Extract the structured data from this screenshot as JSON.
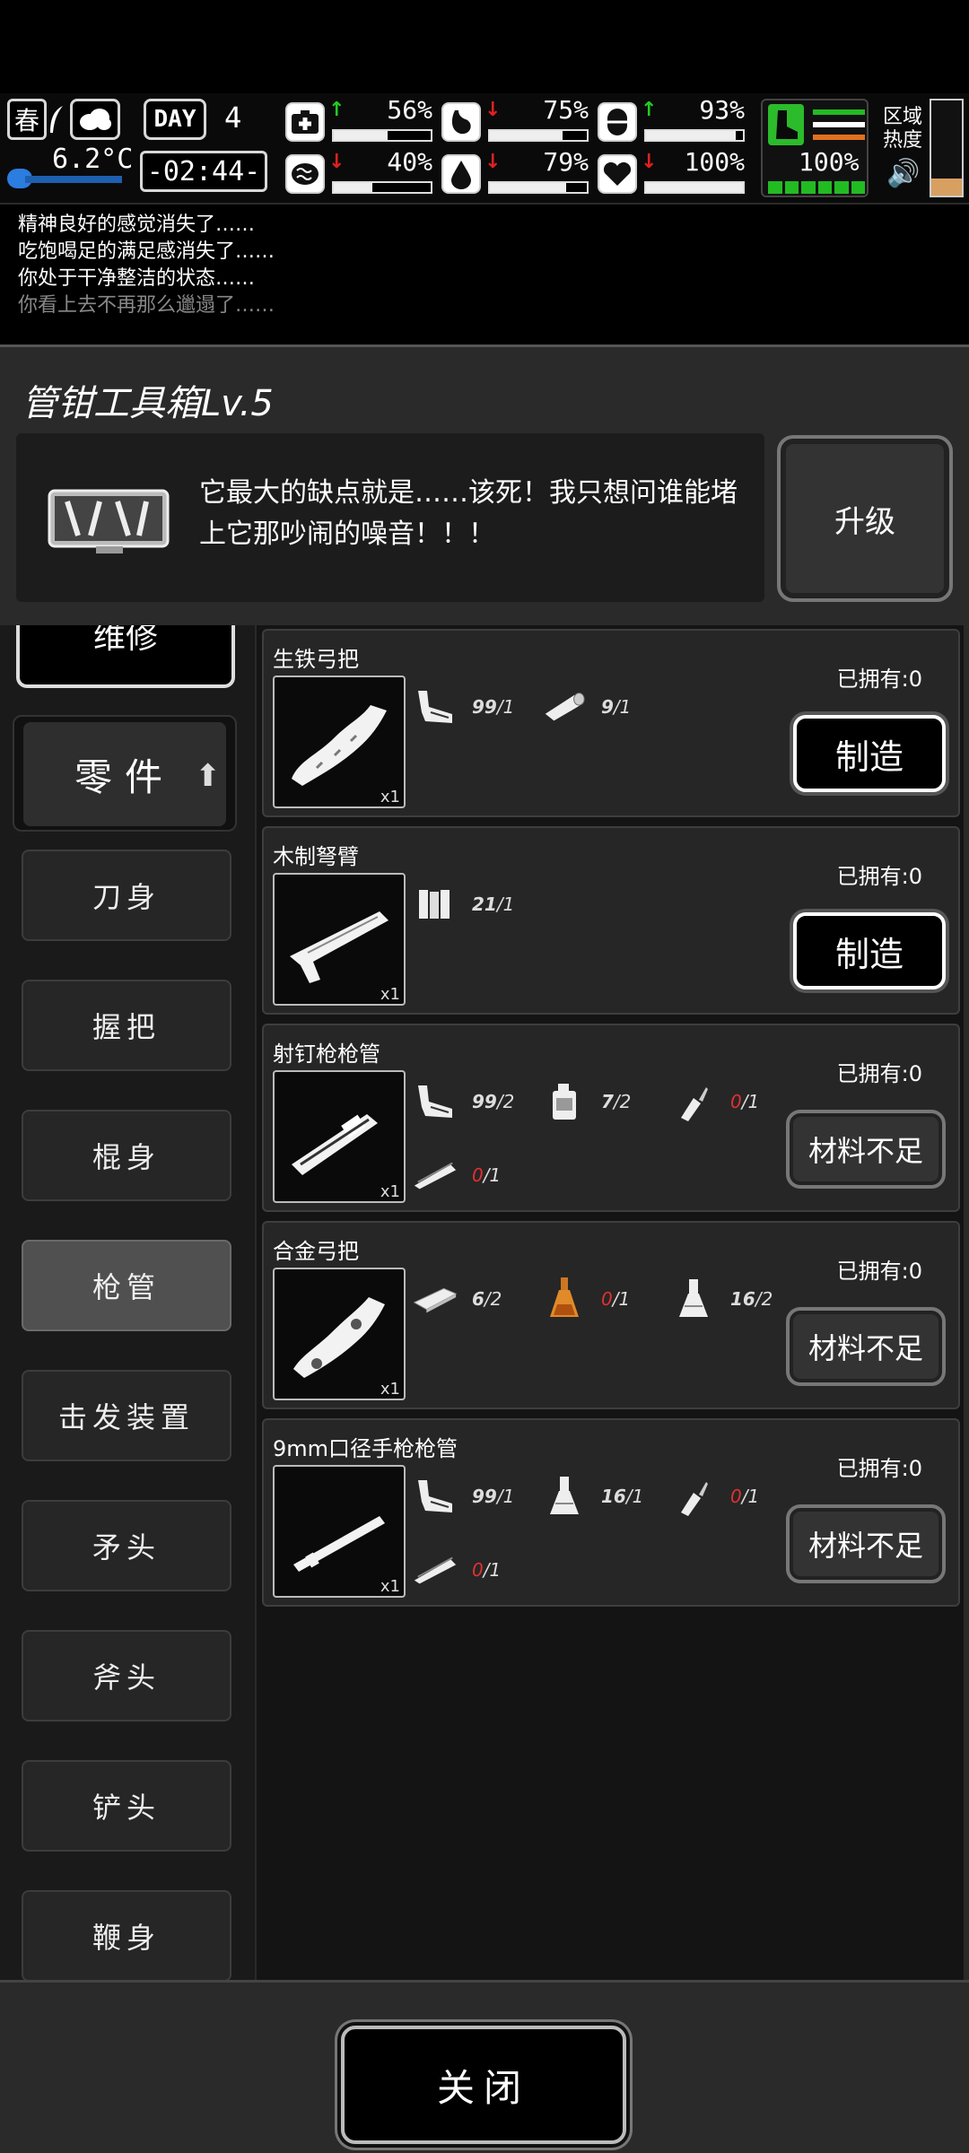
{
  "hud": {
    "season": "春",
    "temperature": "6.2°C",
    "day_label": "DAY",
    "day_number": "4",
    "clock": "-02:44-",
    "stats": [
      {
        "name": "health",
        "icon": "medkit-icon",
        "trend": "up",
        "value": "56%",
        "level": 0.56
      },
      {
        "name": "hunger",
        "icon": "stomach-icon",
        "trend": "down",
        "value": "75%",
        "level": 0.75
      },
      {
        "name": "energy",
        "icon": "pill-icon",
        "trend": "up",
        "value": "93%",
        "level": 0.93
      },
      {
        "name": "mental",
        "icon": "brain-icon",
        "trend": "down",
        "value": "40%",
        "level": 0.4
      },
      {
        "name": "thirst",
        "icon": "water-drop-icon",
        "trend": "down",
        "value": "79%",
        "level": 0.79
      },
      {
        "name": "mood",
        "icon": "heart-icon",
        "trend": "down",
        "value": "100%",
        "level": 1.0
      }
    ],
    "stamina": "100%",
    "zone_heat_label_1": "区域",
    "zone_heat_label_2": "热度",
    "colors": {
      "up": "#22cc22",
      "down": "#e02020",
      "stamina": "#22bb22",
      "heat": "#d8a060"
    }
  },
  "log": [
    "精神良好的感觉消失了……",
    "吃饱喝足的满足感消失了……",
    "你处于干净整洁的状态……",
    "你看上去不再那么邋遢了……"
  ],
  "panel": {
    "title": "管钳工具箱Lv.5",
    "description": "它最大的缺点就是……该死！我只想问谁能堵上它那吵闹的噪音！！！",
    "upgrade_label": "升级"
  },
  "sidebar": {
    "top_category": "维修",
    "selected_category": "零件",
    "subcategories": [
      "刀身",
      "握把",
      "棍身",
      "枪管",
      "击发装置",
      "矛头",
      "斧头",
      "铲头",
      "鞭身"
    ],
    "active_sub": "枪管"
  },
  "recipes": [
    {
      "name": "生铁弓把",
      "owned": "已拥有:0",
      "qty": "x1",
      "materials": [
        {
          "icon": "pipe-wrench-icon",
          "have": "99",
          "need": "1",
          "lacking": false
        },
        {
          "icon": "log-icon",
          "have": "9",
          "need": "1",
          "lacking": false
        }
      ],
      "button": "制造",
      "can_craft": true
    },
    {
      "name": "木制弩臂",
      "owned": "已拥有:0",
      "qty": "x1",
      "materials": [
        {
          "icon": "planks-icon",
          "have": "21",
          "need": "1",
          "lacking": false
        }
      ],
      "button": "制造",
      "can_craft": true
    },
    {
      "name": "射钉枪枪管",
      "owned": "已拥有:0",
      "qty": "x1",
      "materials": [
        {
          "icon": "pipe-wrench-icon",
          "have": "99",
          "need": "2",
          "lacking": false
        },
        {
          "icon": "jerrycan-icon",
          "have": "7",
          "need": "2",
          "lacking": false
        },
        {
          "icon": "glue-bottle-icon",
          "have": "0",
          "need": "1",
          "lacking": true
        },
        {
          "icon": "metal-pipe-icon",
          "have": "0",
          "need": "1",
          "lacking": true
        }
      ],
      "button": "材料不足",
      "can_craft": false
    },
    {
      "name": "合金弓把",
      "owned": "已拥有:0",
      "qty": "x1",
      "materials": [
        {
          "icon": "metal-bar-icon",
          "have": "6",
          "need": "2",
          "lacking": false
        },
        {
          "icon": "potion-flask-icon",
          "have": "0",
          "need": "1",
          "lacking": true
        },
        {
          "icon": "chemical-flask-icon",
          "have": "16",
          "need": "2",
          "lacking": false
        }
      ],
      "button": "材料不足",
      "can_craft": false
    },
    {
      "name": "9mm口径手枪枪管",
      "owned": "已拥有:0",
      "qty": "x1",
      "materials": [
        {
          "icon": "pipe-wrench-icon",
          "have": "99",
          "need": "1",
          "lacking": false
        },
        {
          "icon": "chemical-flask-icon",
          "have": "16",
          "need": "1",
          "lacking": false
        },
        {
          "icon": "glue-bottle-icon",
          "have": "0",
          "need": "1",
          "lacking": true
        },
        {
          "icon": "metal-pipe-icon",
          "have": "0",
          "need": "1",
          "lacking": true
        }
      ],
      "button": "材料不足",
      "can_craft": false
    }
  ],
  "footer": {
    "close_label": "关闭"
  }
}
